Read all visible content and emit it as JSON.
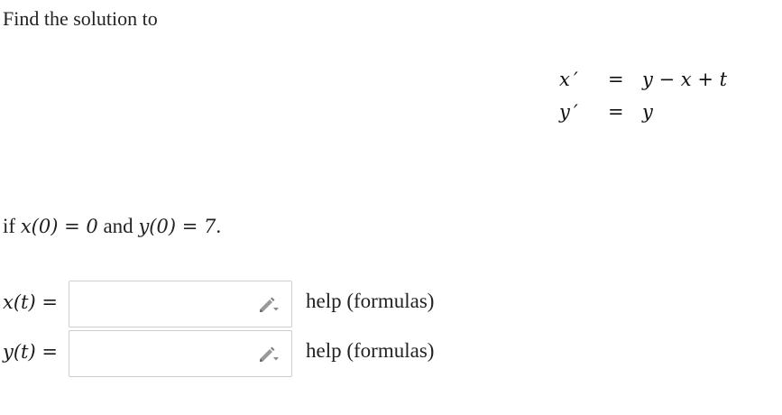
{
  "prompt": "Find the solution to",
  "system": {
    "eq1": {
      "lhs": "x ′",
      "eq": "=",
      "rhs": "y − x + t"
    },
    "eq2": {
      "lhs": "y ′",
      "eq": "=",
      "rhs": "y"
    }
  },
  "condition": {
    "prefix": "if ",
    "x_expr": "x(0) = 0",
    "middle": " and ",
    "y_expr": "y(0) = 7",
    "suffix": "."
  },
  "answers": [
    {
      "label": "x(t) =",
      "value": "",
      "help": "help (formulas)"
    },
    {
      "label": "y(t) =",
      "value": "",
      "help": "help (formulas)"
    }
  ],
  "icons": {
    "pencil": "pencil-icon"
  },
  "colors": {
    "box_border": "#cfcfcf",
    "pencil": "#8a8a8a"
  }
}
